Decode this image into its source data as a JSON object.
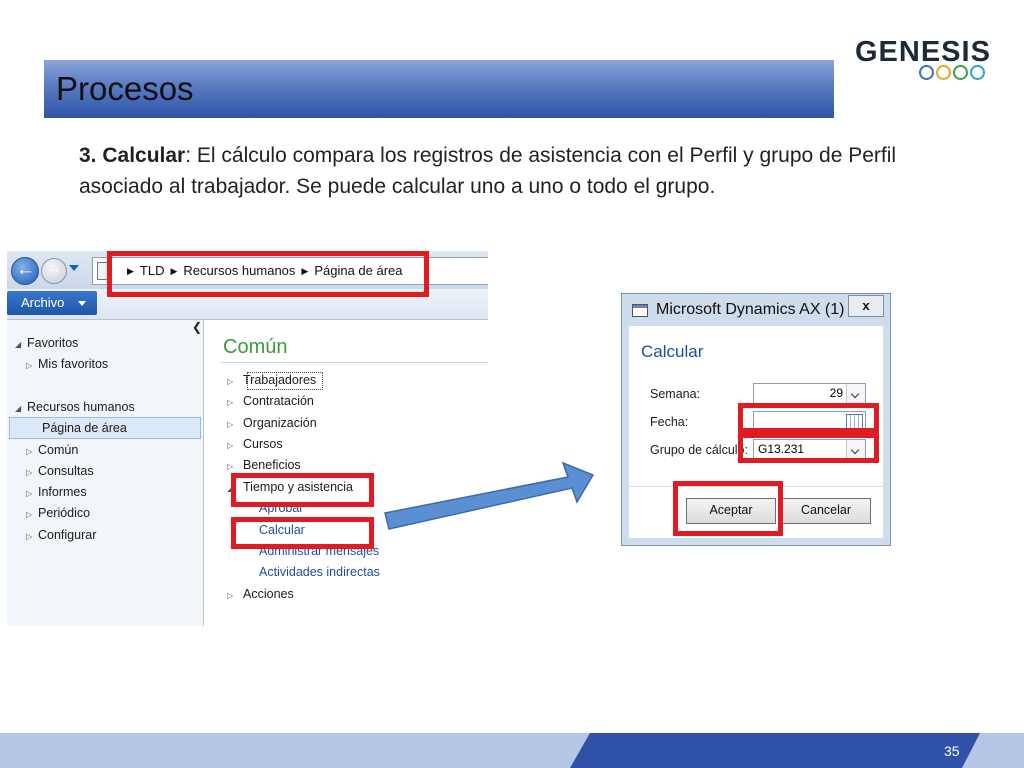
{
  "slide": {
    "title": "Procesos",
    "logo_text": "GENESIS",
    "logo_ring_colors": [
      "#3b6fb5",
      "#e5a823",
      "#3aa04a",
      "#2aa6c9"
    ],
    "description_bold": "3. Calcular",
    "description_rest": ": El cálculo compara los registros de asistencia con el Perfil y grupo de Perfil asociado al trabajador. Se puede calcular uno a uno o todo el grupo.",
    "page_number": "35",
    "highlight_color": "#e11b22"
  },
  "left_window": {
    "breadcrumb": [
      "TLD",
      "Recursos humanos",
      "Página de área"
    ],
    "archivo_label": "Archivo",
    "sidebar": {
      "favoritos": "Favoritos",
      "mis_favoritos": "Mis favoritos",
      "recursos_humanos": "Recursos humanos",
      "items": [
        "Página de área",
        "Común",
        "Consultas",
        "Informes",
        "Periódico",
        "Configurar"
      ]
    },
    "main": {
      "heading": "Común",
      "groups": [
        "Trabajadores",
        "Contratación",
        "Organización",
        "Cursos",
        "Beneficios",
        "Tiempo y asistencia"
      ],
      "sublinks": [
        "Aprobar",
        "Calcular",
        "Administrar mensajes",
        "Actividades indirectas"
      ],
      "last_group": "Acciones"
    }
  },
  "dialog": {
    "title": "Microsoft Dynamics AX (1)",
    "close_label": "x",
    "heading": "Calcular",
    "fields": {
      "semana_label": "Semana:",
      "semana_value": "29",
      "fecha_label": "Fecha:",
      "fecha_value": "",
      "grupo_label": "Grupo de cálculo:",
      "grupo_value": "G13.231"
    },
    "accept_label": "Aceptar",
    "cancel_label": "Cancelar"
  }
}
